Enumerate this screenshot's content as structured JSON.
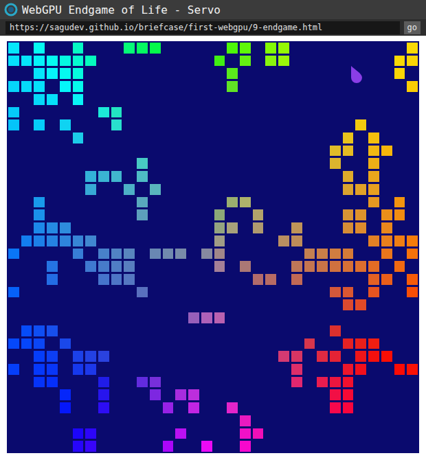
{
  "window": {
    "title": "WebGPU Endgame of Life - Servo"
  },
  "address_bar": {
    "url": "https://sagudev.github.io/briefcase/first-webgpu/9-endgame.html",
    "button": "go"
  },
  "board": {
    "rows": [
      [
        1,
        0,
        1,
        0,
        0,
        1,
        0,
        0,
        0,
        1,
        1,
        1,
        0,
        0,
        0,
        0,
        0,
        1,
        1,
        0,
        1,
        1,
        0,
        0,
        0,
        0,
        0,
        0,
        0,
        0,
        0,
        1
      ],
      [
        1,
        1,
        1,
        1,
        1,
        1,
        1,
        0,
        0,
        0,
        0,
        0,
        0,
        0,
        0,
        0,
        1,
        0,
        1,
        0,
        1,
        1,
        0,
        0,
        0,
        0,
        0,
        0,
        0,
        0,
        1,
        1
      ],
      [
        0,
        0,
        1,
        1,
        1,
        1,
        0,
        0,
        0,
        0,
        0,
        0,
        0,
        0,
        0,
        0,
        0,
        1,
        0,
        0,
        0,
        0,
        0,
        0,
        0,
        0,
        0,
        0,
        0,
        0,
        1,
        0
      ],
      [
        1,
        1,
        1,
        0,
        1,
        1,
        0,
        0,
        0,
        0,
        0,
        0,
        0,
        0,
        0,
        0,
        0,
        1,
        0,
        0,
        0,
        0,
        0,
        0,
        0,
        0,
        0,
        0,
        0,
        0,
        0,
        1
      ],
      [
        0,
        0,
        1,
        1,
        0,
        1,
        0,
        0,
        0,
        0,
        0,
        0,
        0,
        0,
        0,
        0,
        0,
        0,
        0,
        0,
        0,
        0,
        0,
        0,
        0,
        0,
        0,
        0,
        0,
        0,
        0,
        0
      ],
      [
        1,
        0,
        0,
        0,
        0,
        0,
        0,
        1,
        1,
        0,
        0,
        0,
        0,
        0,
        0,
        0,
        0,
        0,
        0,
        0,
        0,
        0,
        0,
        0,
        0,
        0,
        0,
        0,
        0,
        0,
        0,
        0
      ],
      [
        1,
        0,
        1,
        0,
        1,
        0,
        0,
        0,
        1,
        0,
        0,
        0,
        0,
        0,
        0,
        0,
        0,
        0,
        0,
        0,
        0,
        0,
        0,
        0,
        0,
        0,
        0,
        1,
        0,
        0,
        0,
        0
      ],
      [
        0,
        0,
        0,
        0,
        0,
        1,
        0,
        0,
        0,
        0,
        0,
        0,
        0,
        0,
        0,
        0,
        0,
        0,
        0,
        0,
        0,
        0,
        0,
        0,
        0,
        0,
        1,
        0,
        1,
        0,
        0,
        0
      ],
      [
        0,
        0,
        0,
        0,
        0,
        0,
        0,
        0,
        0,
        0,
        0,
        0,
        0,
        0,
        0,
        0,
        0,
        0,
        0,
        0,
        0,
        0,
        0,
        0,
        0,
        1,
        1,
        0,
        1,
        1,
        0,
        0
      ],
      [
        0,
        0,
        0,
        0,
        0,
        0,
        0,
        0,
        0,
        0,
        1,
        0,
        0,
        0,
        0,
        0,
        0,
        0,
        0,
        0,
        0,
        0,
        0,
        0,
        0,
        1,
        0,
        0,
        1,
        0,
        0,
        0
      ],
      [
        0,
        0,
        0,
        0,
        0,
        0,
        1,
        1,
        1,
        0,
        1,
        0,
        0,
        0,
        0,
        0,
        0,
        0,
        0,
        0,
        0,
        0,
        0,
        0,
        0,
        0,
        1,
        0,
        1,
        0,
        0,
        0
      ],
      [
        0,
        0,
        0,
        0,
        0,
        0,
        1,
        0,
        0,
        1,
        0,
        1,
        0,
        0,
        0,
        0,
        0,
        0,
        0,
        0,
        0,
        0,
        0,
        0,
        0,
        0,
        1,
        1,
        1,
        0,
        0,
        0
      ],
      [
        0,
        0,
        1,
        0,
        0,
        0,
        0,
        0,
        0,
        0,
        1,
        0,
        0,
        0,
        0,
        0,
        0,
        1,
        1,
        0,
        0,
        0,
        0,
        0,
        0,
        0,
        0,
        0,
        1,
        0,
        1,
        0
      ],
      [
        0,
        0,
        1,
        0,
        0,
        0,
        0,
        0,
        0,
        0,
        1,
        0,
        0,
        0,
        0,
        0,
        1,
        0,
        0,
        1,
        0,
        0,
        0,
        0,
        0,
        0,
        1,
        1,
        0,
        1,
        1,
        0
      ],
      [
        0,
        0,
        1,
        1,
        1,
        0,
        0,
        0,
        0,
        0,
        0,
        0,
        0,
        0,
        0,
        0,
        1,
        1,
        0,
        1,
        0,
        0,
        1,
        0,
        0,
        0,
        1,
        1,
        0,
        1,
        0,
        0
      ],
      [
        0,
        1,
        1,
        1,
        1,
        1,
        1,
        0,
        0,
        0,
        0,
        0,
        0,
        0,
        0,
        0,
        1,
        0,
        0,
        0,
        0,
        1,
        1,
        0,
        0,
        0,
        0,
        0,
        1,
        1,
        1,
        1
      ],
      [
        1,
        0,
        0,
        0,
        0,
        1,
        0,
        1,
        1,
        1,
        0,
        1,
        1,
        1,
        0,
        1,
        1,
        0,
        0,
        0,
        0,
        0,
        0,
        1,
        1,
        1,
        1,
        0,
        0,
        1,
        0,
        1
      ],
      [
        0,
        0,
        0,
        1,
        0,
        0,
        1,
        1,
        1,
        1,
        0,
        0,
        0,
        0,
        0,
        0,
        1,
        0,
        1,
        0,
        0,
        0,
        1,
        1,
        1,
        1,
        1,
        1,
        1,
        0,
        1,
        0
      ],
      [
        0,
        0,
        0,
        1,
        0,
        0,
        0,
        1,
        1,
        1,
        0,
        0,
        0,
        0,
        0,
        0,
        0,
        0,
        0,
        1,
        1,
        0,
        1,
        0,
        0,
        0,
        0,
        0,
        1,
        1,
        0,
        1
      ],
      [
        1,
        0,
        0,
        0,
        0,
        0,
        0,
        0,
        0,
        0,
        1,
        0,
        0,
        0,
        0,
        0,
        0,
        0,
        0,
        0,
        0,
        0,
        0,
        0,
        0,
        1,
        1,
        0,
        1,
        0,
        0,
        1
      ],
      [
        0,
        0,
        0,
        0,
        0,
        0,
        0,
        0,
        0,
        0,
        0,
        0,
        0,
        0,
        0,
        0,
        0,
        0,
        0,
        0,
        0,
        0,
        0,
        0,
        0,
        0,
        1,
        1,
        0,
        0,
        0,
        0
      ],
      [
        0,
        0,
        0,
        0,
        0,
        0,
        0,
        0,
        0,
        0,
        0,
        0,
        0,
        0,
        1,
        1,
        1,
        0,
        0,
        0,
        0,
        0,
        0,
        0,
        0,
        0,
        0,
        0,
        0,
        0,
        0,
        0
      ],
      [
        0,
        1,
        1,
        1,
        0,
        0,
        0,
        0,
        0,
        0,
        0,
        0,
        0,
        0,
        0,
        0,
        0,
        0,
        0,
        0,
        0,
        0,
        0,
        0,
        0,
        1,
        0,
        0,
        0,
        0,
        0,
        0
      ],
      [
        1,
        1,
        1,
        0,
        1,
        0,
        0,
        0,
        0,
        0,
        0,
        0,
        0,
        0,
        0,
        0,
        0,
        0,
        0,
        0,
        0,
        0,
        0,
        1,
        0,
        0,
        1,
        1,
        1,
        0,
        0,
        0
      ],
      [
        0,
        0,
        1,
        1,
        0,
        1,
        1,
        1,
        0,
        0,
        0,
        0,
        0,
        0,
        0,
        0,
        0,
        0,
        0,
        0,
        0,
        1,
        1,
        0,
        1,
        1,
        0,
        1,
        1,
        1,
        0,
        0
      ],
      [
        1,
        0,
        1,
        1,
        0,
        1,
        1,
        0,
        0,
        0,
        0,
        0,
        0,
        0,
        0,
        0,
        0,
        0,
        0,
        0,
        0,
        0,
        1,
        0,
        0,
        0,
        1,
        1,
        0,
        0,
        1,
        1
      ],
      [
        0,
        0,
        1,
        1,
        0,
        0,
        0,
        1,
        0,
        0,
        1,
        1,
        0,
        0,
        0,
        0,
        0,
        0,
        0,
        0,
        0,
        0,
        1,
        0,
        1,
        1,
        1,
        0,
        0,
        0,
        0,
        0
      ],
      [
        0,
        0,
        0,
        0,
        1,
        0,
        0,
        1,
        0,
        0,
        0,
        1,
        0,
        1,
        1,
        0,
        0,
        0,
        0,
        0,
        0,
        0,
        0,
        0,
        0,
        1,
        1,
        0,
        0,
        0,
        0,
        0
      ],
      [
        0,
        0,
        0,
        0,
        1,
        0,
        0,
        1,
        0,
        0,
        0,
        0,
        1,
        0,
        1,
        0,
        0,
        1,
        0,
        0,
        0,
        0,
        0,
        0,
        0,
        1,
        1,
        0,
        0,
        0,
        0,
        0
      ],
      [
        0,
        0,
        0,
        0,
        0,
        0,
        0,
        0,
        0,
        0,
        0,
        0,
        0,
        0,
        0,
        0,
        0,
        0,
        1,
        0,
        0,
        0,
        0,
        0,
        0,
        0,
        0,
        0,
        0,
        0,
        0,
        0
      ],
      [
        0,
        0,
        0,
        0,
        0,
        1,
        1,
        0,
        0,
        0,
        0,
        0,
        0,
        1,
        0,
        0,
        0,
        0,
        1,
        1,
        0,
        0,
        0,
        0,
        0,
        0,
        0,
        0,
        0,
        0,
        0,
        0
      ],
      [
        0,
        0,
        0,
        0,
        0,
        1,
        1,
        0,
        0,
        0,
        0,
        0,
        1,
        0,
        0,
        1,
        0,
        0,
        1,
        0,
        0,
        0,
        0,
        0,
        0,
        0,
        0,
        0,
        0,
        0,
        0,
        0
      ]
    ]
  }
}
